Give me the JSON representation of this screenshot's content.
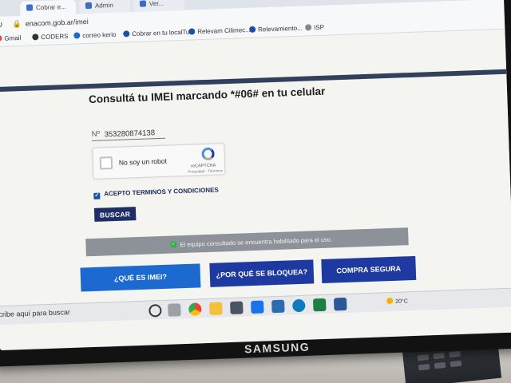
{
  "browser": {
    "tabs": [
      {
        "label": "Cobrar e..."
      },
      {
        "label": "Admin"
      },
      {
        "label": "Ver..."
      }
    ],
    "url": "enacom.gob.ar/imei",
    "bookmarks": [
      {
        "label": "Gmail"
      },
      {
        "label": "CODERS"
      },
      {
        "label": "correo kerio"
      },
      {
        "label": "Cobrar en tu localTu..."
      },
      {
        "label": "Relevam Cilimec..."
      },
      {
        "label": "Relevamiento..."
      },
      {
        "label": "ISP"
      }
    ]
  },
  "page": {
    "title": "Consultá tu IMEI marcando *#06# en tu celular",
    "imei_prefix": "Nº",
    "imei_value": "353280874138",
    "captcha_label": "No soy un robot",
    "captcha_brand": "reCAPTCHA",
    "captcha_links": "Privacidad - Términos",
    "terms_label": "ACEPTO TERMINOS Y CONDICIONES",
    "search_button": "BUSCAR",
    "status_message": "El equipo consultado se encuentra habilitado para el uso.",
    "buttons": {
      "what_is": "¿QUÉ ES IMEI?",
      "why_blocked": "¿POR QUÉ SE BLOQUEA?",
      "safe_buy": "COMPRA SEGURA"
    }
  },
  "taskbar": {
    "search_text": "cribe aquí para buscar",
    "weather": "20°C",
    "tray_icons": [
      "start-icon",
      "task-view-icon",
      "chrome-icon",
      "explorer-icon",
      "calculator-icon",
      "mail-icon",
      "app-icon",
      "edge-icon",
      "excel-icon",
      "word-icon"
    ]
  },
  "monitor": {
    "brand": "SAMSUNG"
  },
  "colors": {
    "primary": "#1e3aa0",
    "accent": "#1c6ad0",
    "status_bg": "#8c9297",
    "success": "#2fb14c"
  }
}
